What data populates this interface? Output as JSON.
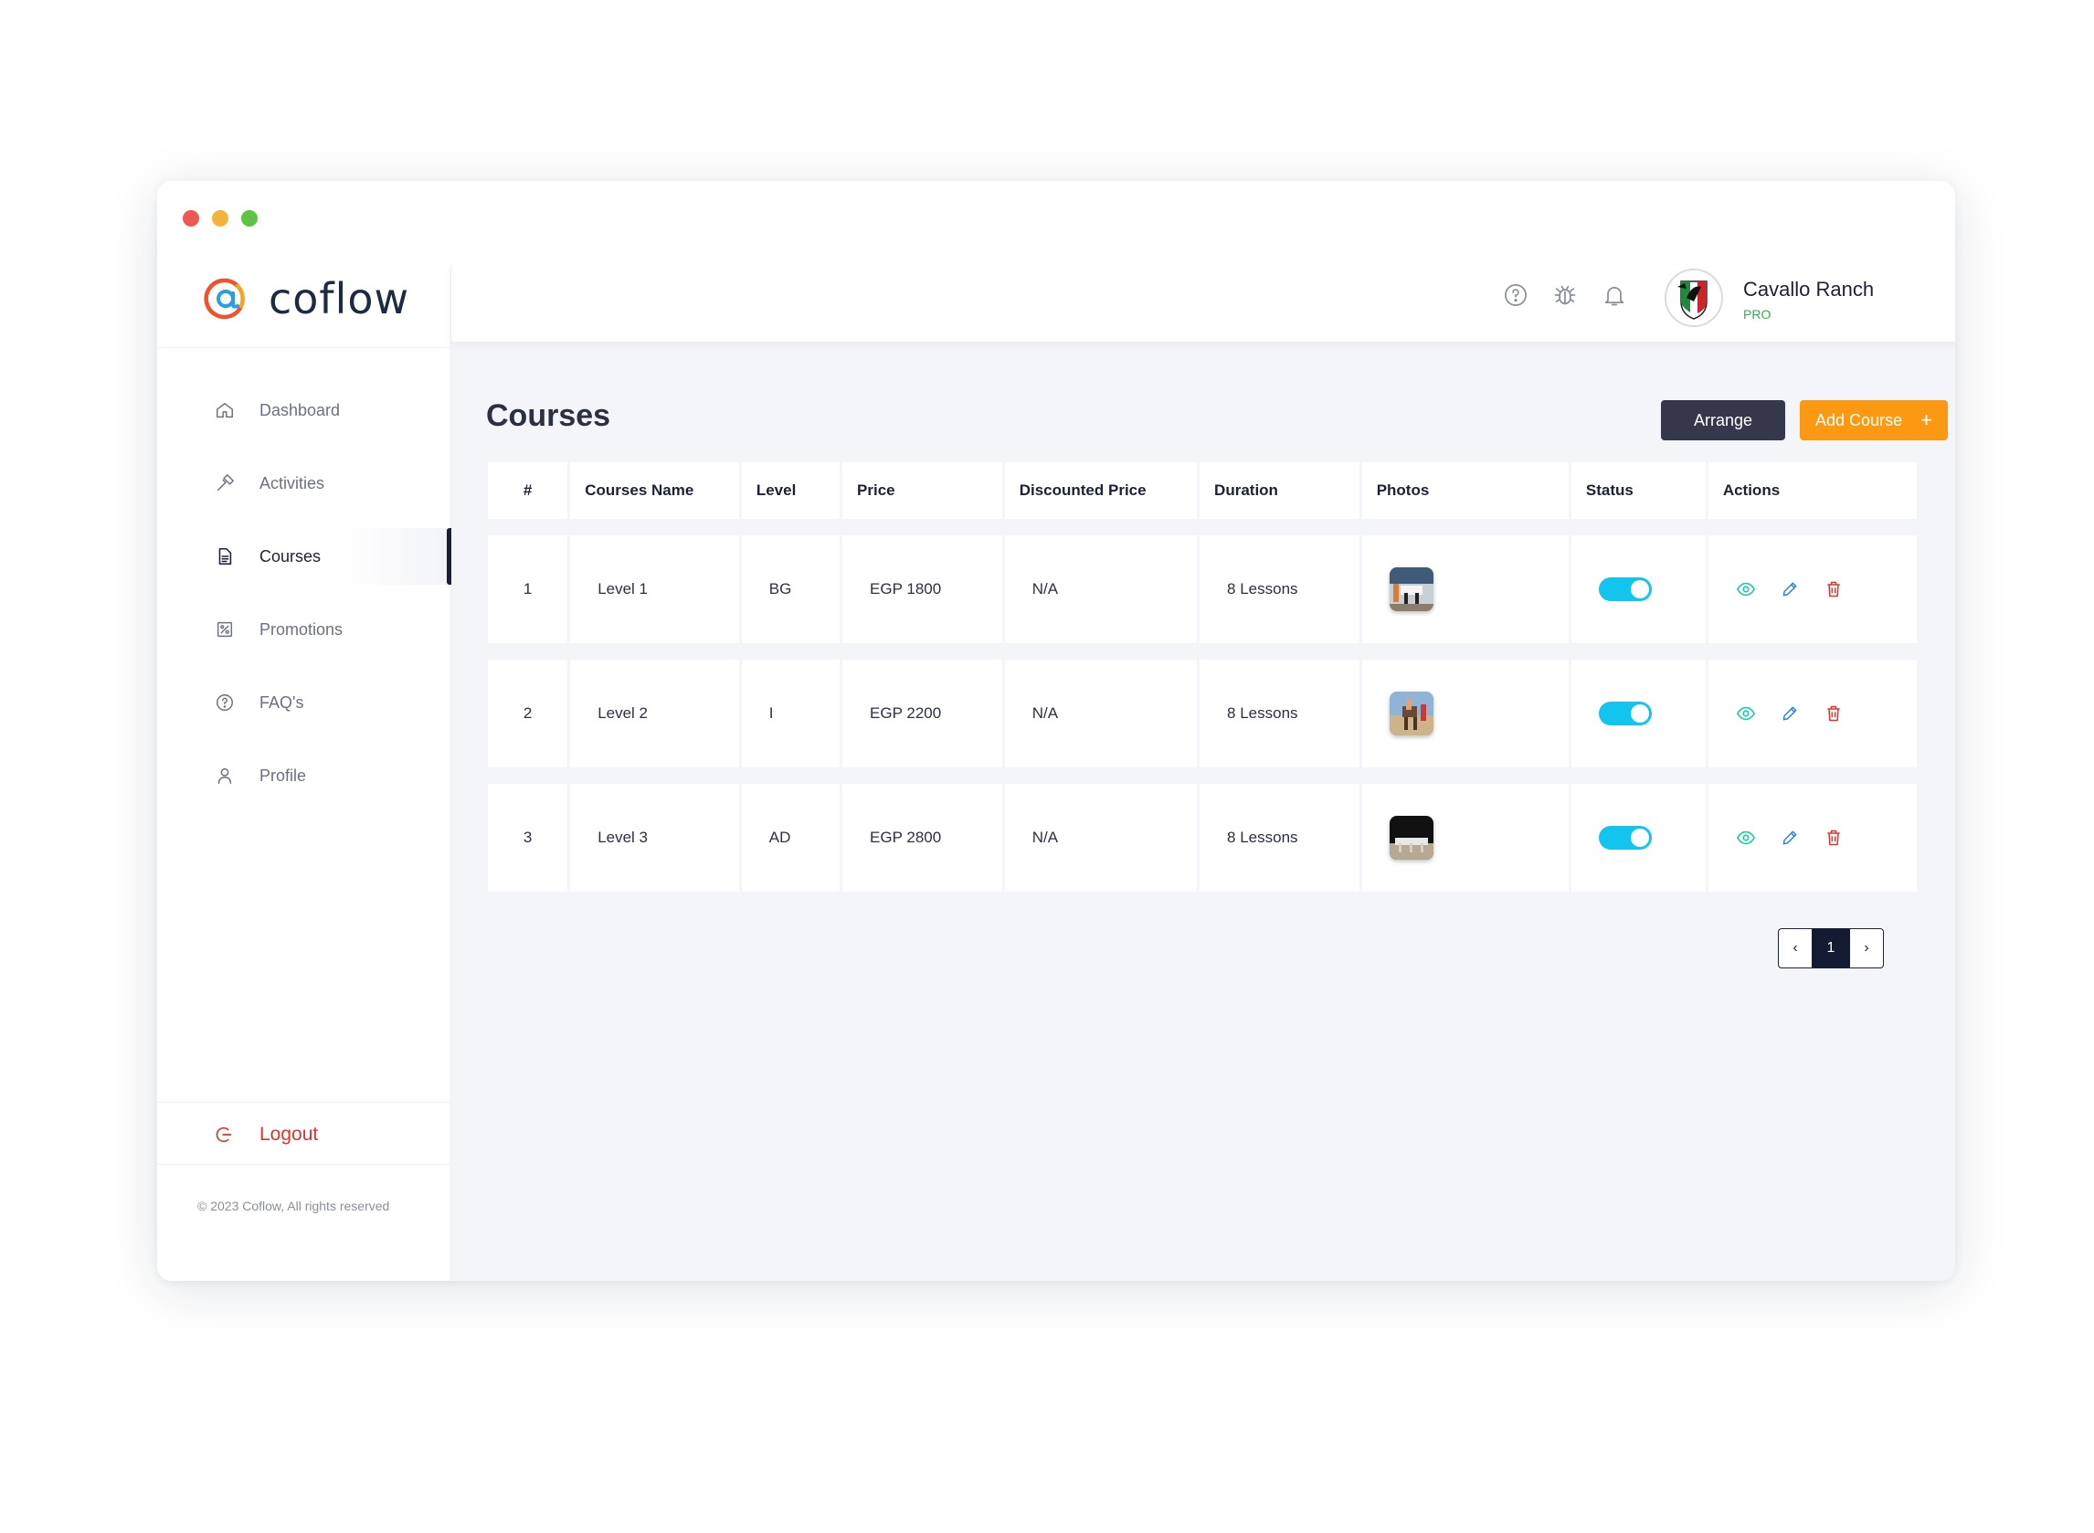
{
  "app": {
    "logo_text": "coflow"
  },
  "sidebar": {
    "items": [
      {
        "label": "Dashboard",
        "icon": "home-icon"
      },
      {
        "label": "Activities",
        "icon": "hammer-icon"
      },
      {
        "label": "Courses",
        "icon": "document-icon",
        "active": true
      },
      {
        "label": "Promotions",
        "icon": "percent-icon"
      },
      {
        "label": "FAQ's",
        "icon": "help-circle-icon"
      },
      {
        "label": "Profile",
        "icon": "user-icon"
      }
    ],
    "logout_label": "Logout",
    "copyright": "© 2023 Coflow, All rights reserved"
  },
  "topbar": {
    "user_name": "Cavallo Ranch",
    "user_plan": "PRO",
    "icons": [
      "help-circle-icon",
      "bug-icon",
      "bell-icon"
    ]
  },
  "main": {
    "title": "Courses",
    "arrange_label": "Arrange",
    "add_label": "Add Course",
    "add_icon": "+"
  },
  "table": {
    "headers": [
      "#",
      "Courses Name",
      "Level",
      "Price",
      "Discounted Price",
      "Duration",
      "Photos",
      "Status",
      "Actions"
    ],
    "rows": [
      {
        "num": "1",
        "name": "Level 1",
        "level": "BG",
        "price": "EGP 1800",
        "discounted": "N/A",
        "duration": "8 Lessons",
        "status_on": true
      },
      {
        "num": "2",
        "name": "Level 2",
        "level": "I",
        "price": "EGP 2200",
        "discounted": "N/A",
        "duration": "8 Lessons",
        "status_on": true
      },
      {
        "num": "3",
        "name": "Level 3",
        "level": "AD",
        "price": "EGP 2800",
        "discounted": "N/A",
        "duration": "8 Lessons",
        "status_on": true
      }
    ]
  },
  "pagination": {
    "prev": "‹",
    "current": "1",
    "next": "›"
  },
  "colors": {
    "accent_orange": "#fb9a12",
    "dark_button": "#34384a",
    "toggle_on": "#13c4ef",
    "view_icon": "#1ec9a5",
    "edit_icon": "#2f86d8",
    "delete_icon": "#e0322e",
    "logout": "#e0322e",
    "plan": "#2eb24b"
  }
}
